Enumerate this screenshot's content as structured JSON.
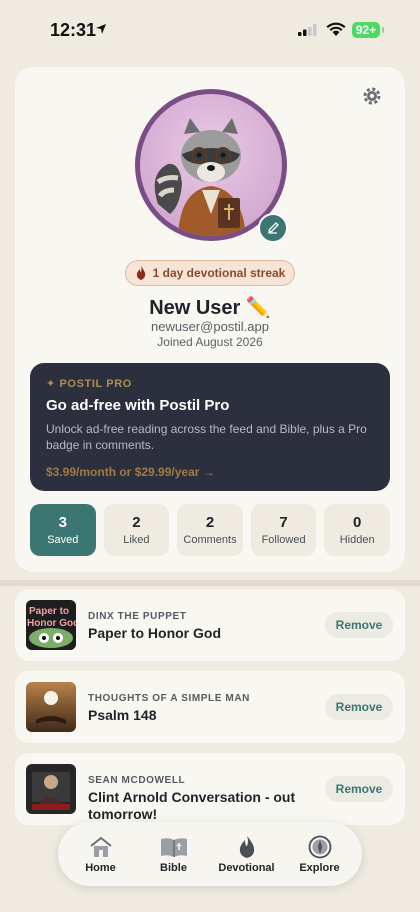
{
  "status": {
    "time": "12:31",
    "battery": "92+"
  },
  "profile": {
    "streak": "1 day devotional streak",
    "name": "New User ✏️",
    "email": "newuser@postil.app",
    "joined": "Joined August 2026"
  },
  "pro": {
    "tag": "✦ POSTIL PRO",
    "title": "Go ad-free with Postil Pro",
    "description": "Unlock ad-free reading across the feed and Bible, plus a Pro badge in comments.",
    "price": "$3.99/month or $29.99/year →"
  },
  "stats": [
    {
      "value": "3",
      "label": "Saved",
      "active": true
    },
    {
      "value": "2",
      "label": "Liked",
      "active": false
    },
    {
      "value": "2",
      "label": "Comments",
      "active": false
    },
    {
      "value": "7",
      "label": "Followed",
      "active": false
    },
    {
      "value": "0",
      "label": "Hidden",
      "active": false
    }
  ],
  "saved_items": [
    {
      "author": "DINX THE PUPPET",
      "title": "Paper to Honor God",
      "thumb_text": "Paper to Honor God",
      "action": "Remove"
    },
    {
      "author": "THOUGHTS OF A SIMPLE MAN",
      "title": "Psalm 148",
      "action": "Remove"
    },
    {
      "author": "SEAN MCDOWELL",
      "title": "Clint Arnold Conversation - out tomorrow!",
      "action": "Remove"
    }
  ],
  "tabs": [
    {
      "label": "Home",
      "icon": "home-icon"
    },
    {
      "label": "Bible",
      "icon": "bible-icon"
    },
    {
      "label": "Devotional",
      "icon": "flame-icon"
    },
    {
      "label": "Explore",
      "icon": "compass-icon"
    }
  ],
  "colors": {
    "accent": "#3c7673",
    "pro_bg": "#2c2f3d",
    "pro_gold": "#b08d52",
    "avatar_ring": "#7b4d86"
  }
}
